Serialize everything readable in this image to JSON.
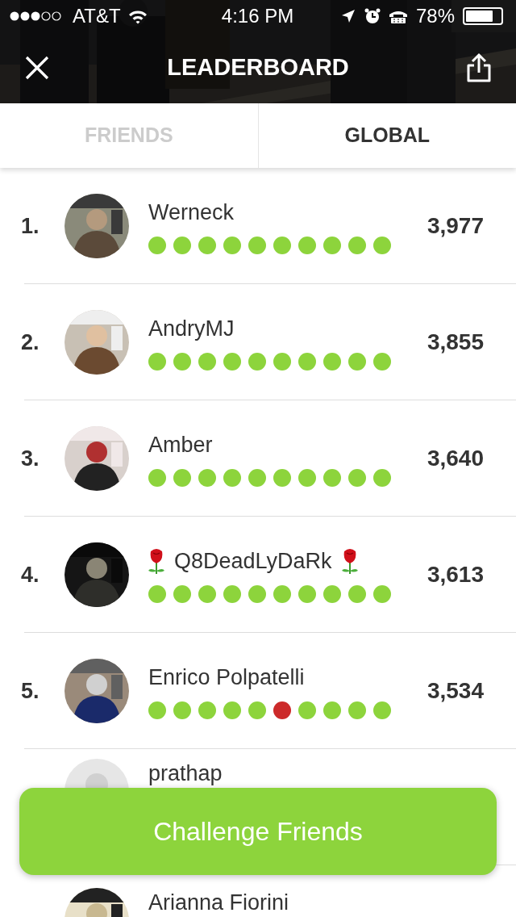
{
  "status_bar": {
    "carrier": "AT&T",
    "time": "4:16 PM",
    "battery": "78%"
  },
  "header": {
    "title": "LEADERBOARD"
  },
  "tabs": [
    {
      "label": "FRIENDS",
      "selected": false
    },
    {
      "label": "GLOBAL",
      "selected": true
    }
  ],
  "rows": [
    {
      "rank": "1.",
      "name": "Werneck",
      "score": "3,977",
      "has_photo": true,
      "roses": false,
      "answers": [
        true,
        true,
        true,
        true,
        true,
        true,
        true,
        true,
        true,
        true
      ]
    },
    {
      "rank": "2.",
      "name": "AndryMJ",
      "score": "3,855",
      "has_photo": true,
      "roses": false,
      "answers": [
        true,
        true,
        true,
        true,
        true,
        true,
        true,
        true,
        true,
        true
      ]
    },
    {
      "rank": "3.",
      "name": "Amber",
      "score": "3,640",
      "has_photo": true,
      "roses": false,
      "answers": [
        true,
        true,
        true,
        true,
        true,
        true,
        true,
        true,
        true,
        true
      ]
    },
    {
      "rank": "4.",
      "name": "Q8DeadLyDaRk",
      "score": "3,613",
      "has_photo": true,
      "roses": true,
      "answers": [
        true,
        true,
        true,
        true,
        true,
        true,
        true,
        true,
        true,
        true
      ]
    },
    {
      "rank": "5.",
      "name": "Enrico Polpatelli",
      "score": "3,534",
      "has_photo": true,
      "roses": false,
      "answers": [
        true,
        true,
        true,
        true,
        true,
        false,
        true,
        true,
        true,
        true
      ]
    },
    {
      "name": "prathap",
      "has_photo": false,
      "roses": false
    },
    {
      "name": "Arianna Fiorini",
      "has_photo": true,
      "roses": false
    }
  ],
  "action_button": {
    "label": "Challenge Friends"
  }
}
